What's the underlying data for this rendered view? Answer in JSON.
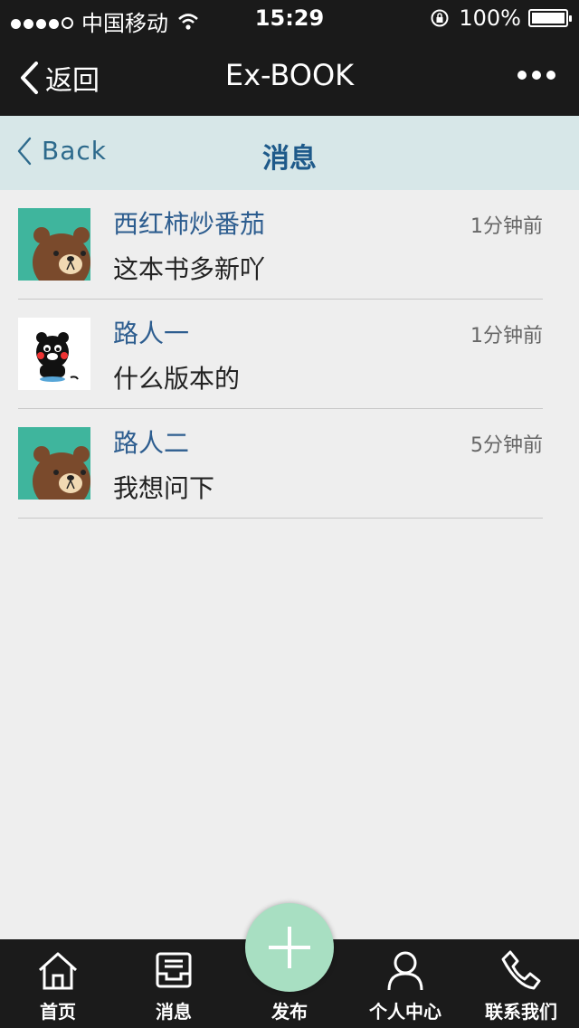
{
  "status": {
    "carrier": "中国移动",
    "time": "15:29",
    "battery": "100%"
  },
  "nav": {
    "back_label": "返回",
    "title": "Ex-BOOK"
  },
  "sub": {
    "back_label": "Back",
    "title": "消息"
  },
  "messages": [
    {
      "name": "西红柿炒番茄",
      "text": "这本书多新吖",
      "ago": "1分钟前"
    },
    {
      "name": "路人一",
      "text": "什么版本的",
      "ago": "1分钟前"
    },
    {
      "name": "路人二",
      "text": "我想问下",
      "ago": "5分钟前"
    }
  ],
  "tabs": [
    {
      "label": "首页",
      "icon": "home-icon"
    },
    {
      "label": "消息",
      "icon": "inbox-icon"
    },
    {
      "label": "发布",
      "icon": "plus-icon"
    },
    {
      "label": "个人中心",
      "icon": "person-icon"
    },
    {
      "label": "联系我们",
      "icon": "phone-icon"
    }
  ],
  "colors": {
    "accent": "#2d5d8f",
    "fab": "#a8dfc2",
    "subheader": "#d7e7e8"
  }
}
